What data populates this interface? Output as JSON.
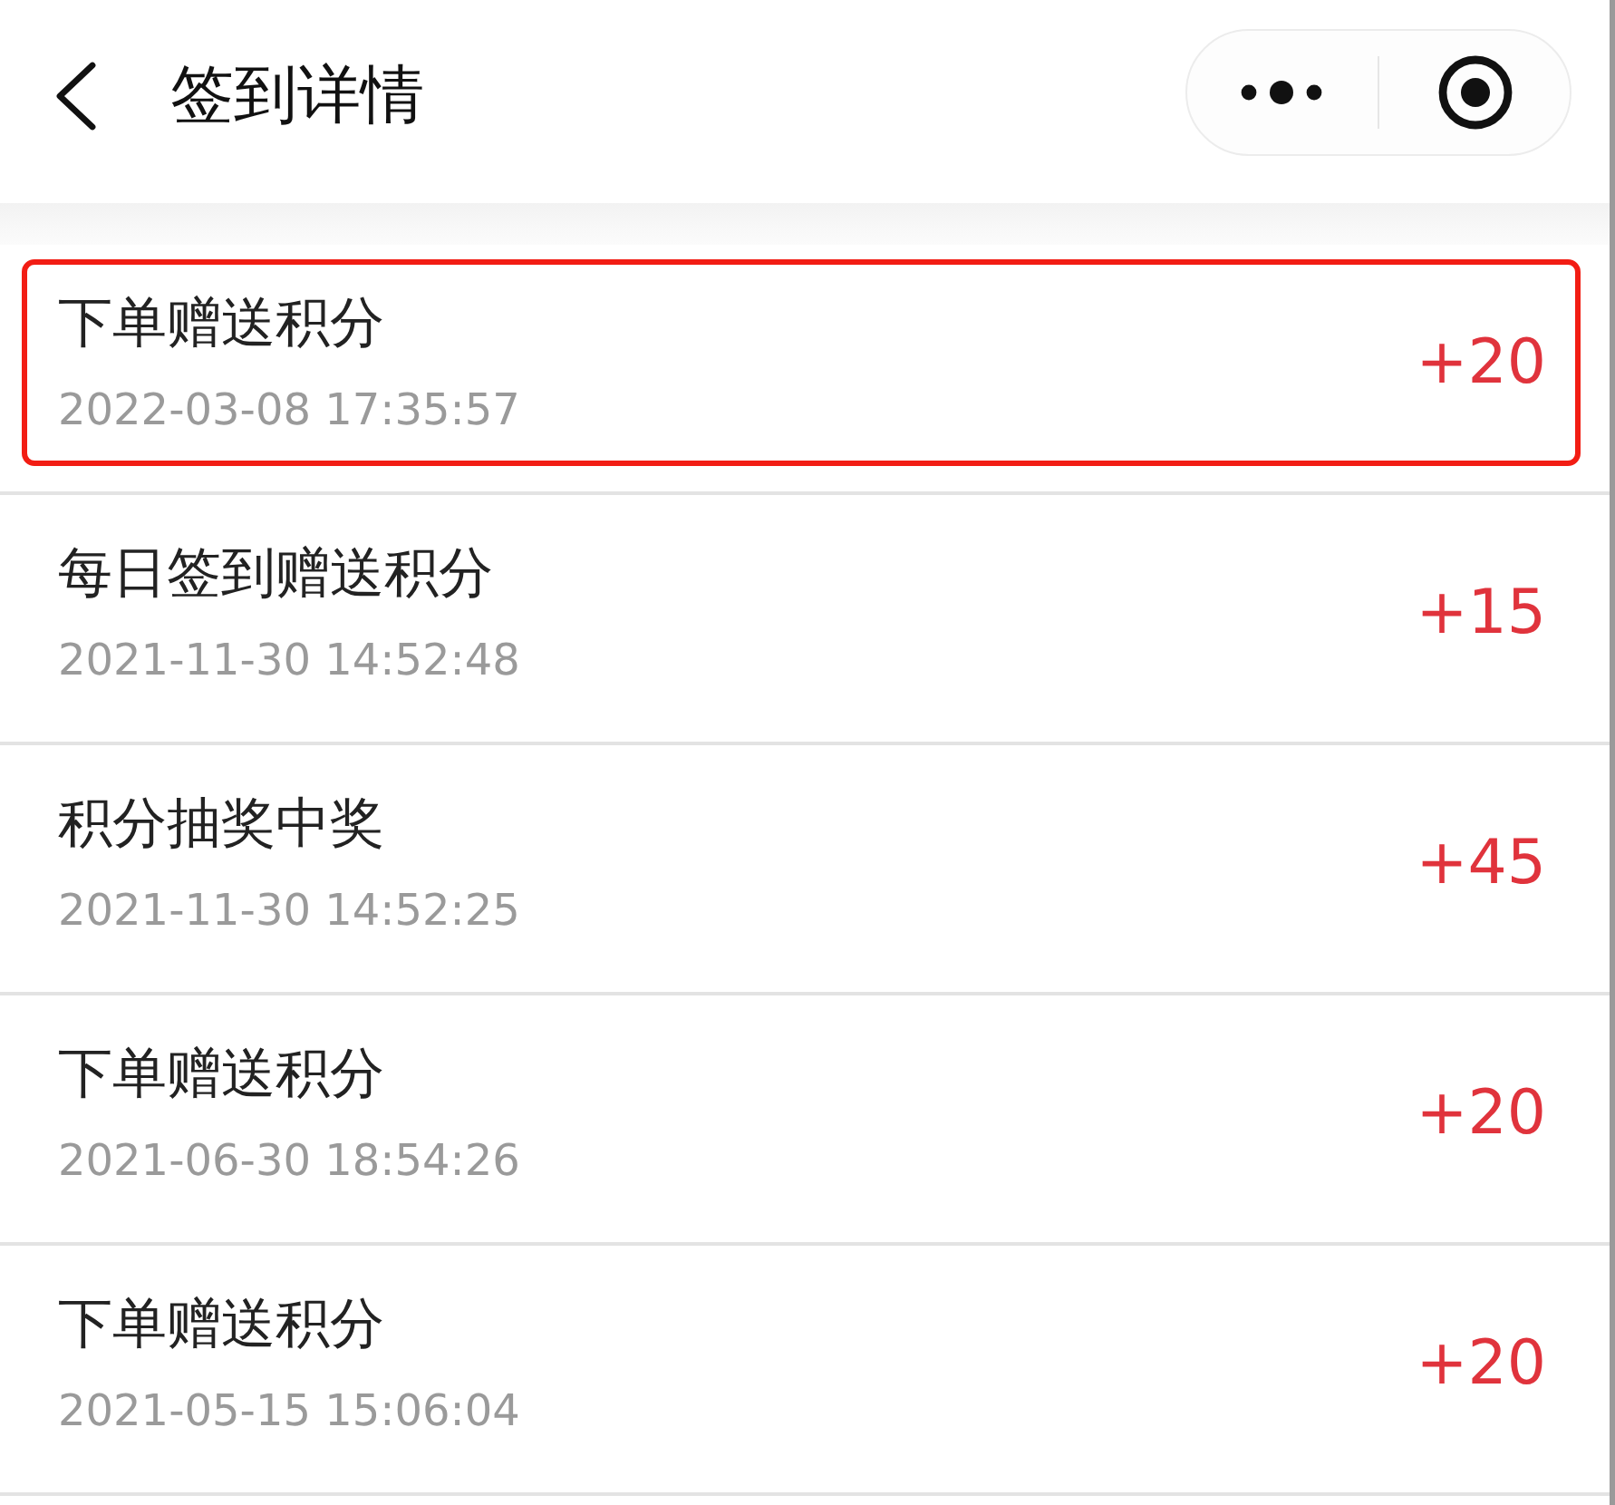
{
  "header": {
    "title": "签到详情"
  },
  "records": [
    {
      "title": "下单赠送积分",
      "time": "2022-03-08 17:35:57",
      "points": "+20",
      "highlighted": true
    },
    {
      "title": "每日签到赠送积分",
      "time": "2021-11-30 14:52:48",
      "points": "+15",
      "highlighted": false
    },
    {
      "title": "积分抽奖中奖",
      "time": "2021-11-30 14:52:25",
      "points": "+45",
      "highlighted": false
    },
    {
      "title": "下单赠送积分",
      "time": "2021-06-30 18:54:26",
      "points": "+20",
      "highlighted": false
    },
    {
      "title": "下单赠送积分",
      "time": "2021-05-15 15:06:04",
      "points": "+20",
      "highlighted": false
    }
  ]
}
